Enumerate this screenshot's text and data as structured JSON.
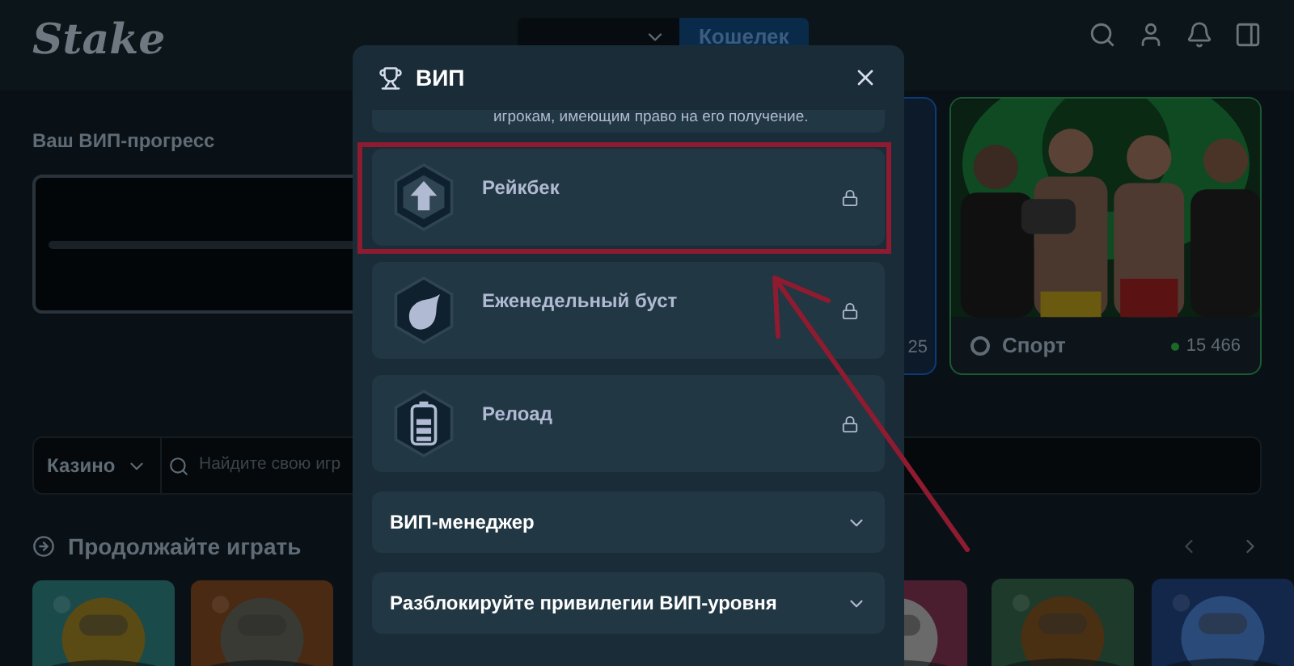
{
  "header": {
    "logo": "Stake",
    "wallet_button": "Кошелек"
  },
  "vip_progress": {
    "title": "Ваш ВИП-прогресс"
  },
  "side_card": {
    "count": "25"
  },
  "sport_card": {
    "label": "Спорт",
    "online_count": "15 466"
  },
  "search": {
    "category": "Казино",
    "placeholder": "Найдите свою игр"
  },
  "continue_section": {
    "title": "Продолжайте играть"
  },
  "modal": {
    "title": "ВИП",
    "intro_tail": "игрокам, имеющим право на его получение.",
    "perks": [
      {
        "kind": "rakeback",
        "title": "Рейкбек",
        "locked": true,
        "highlighted": true
      },
      {
        "kind": "boost",
        "title": "Еженедельный буст",
        "locked": true,
        "highlighted": false
      },
      {
        "kind": "reload",
        "title": "Релоад",
        "locked": true,
        "highlighted": false
      }
    ],
    "accordions": [
      {
        "title": "ВИП-менеджер",
        "expanded": false
      },
      {
        "title": "Разблокируйте привилегии ВИП-уровня",
        "expanded": false
      }
    ]
  }
}
